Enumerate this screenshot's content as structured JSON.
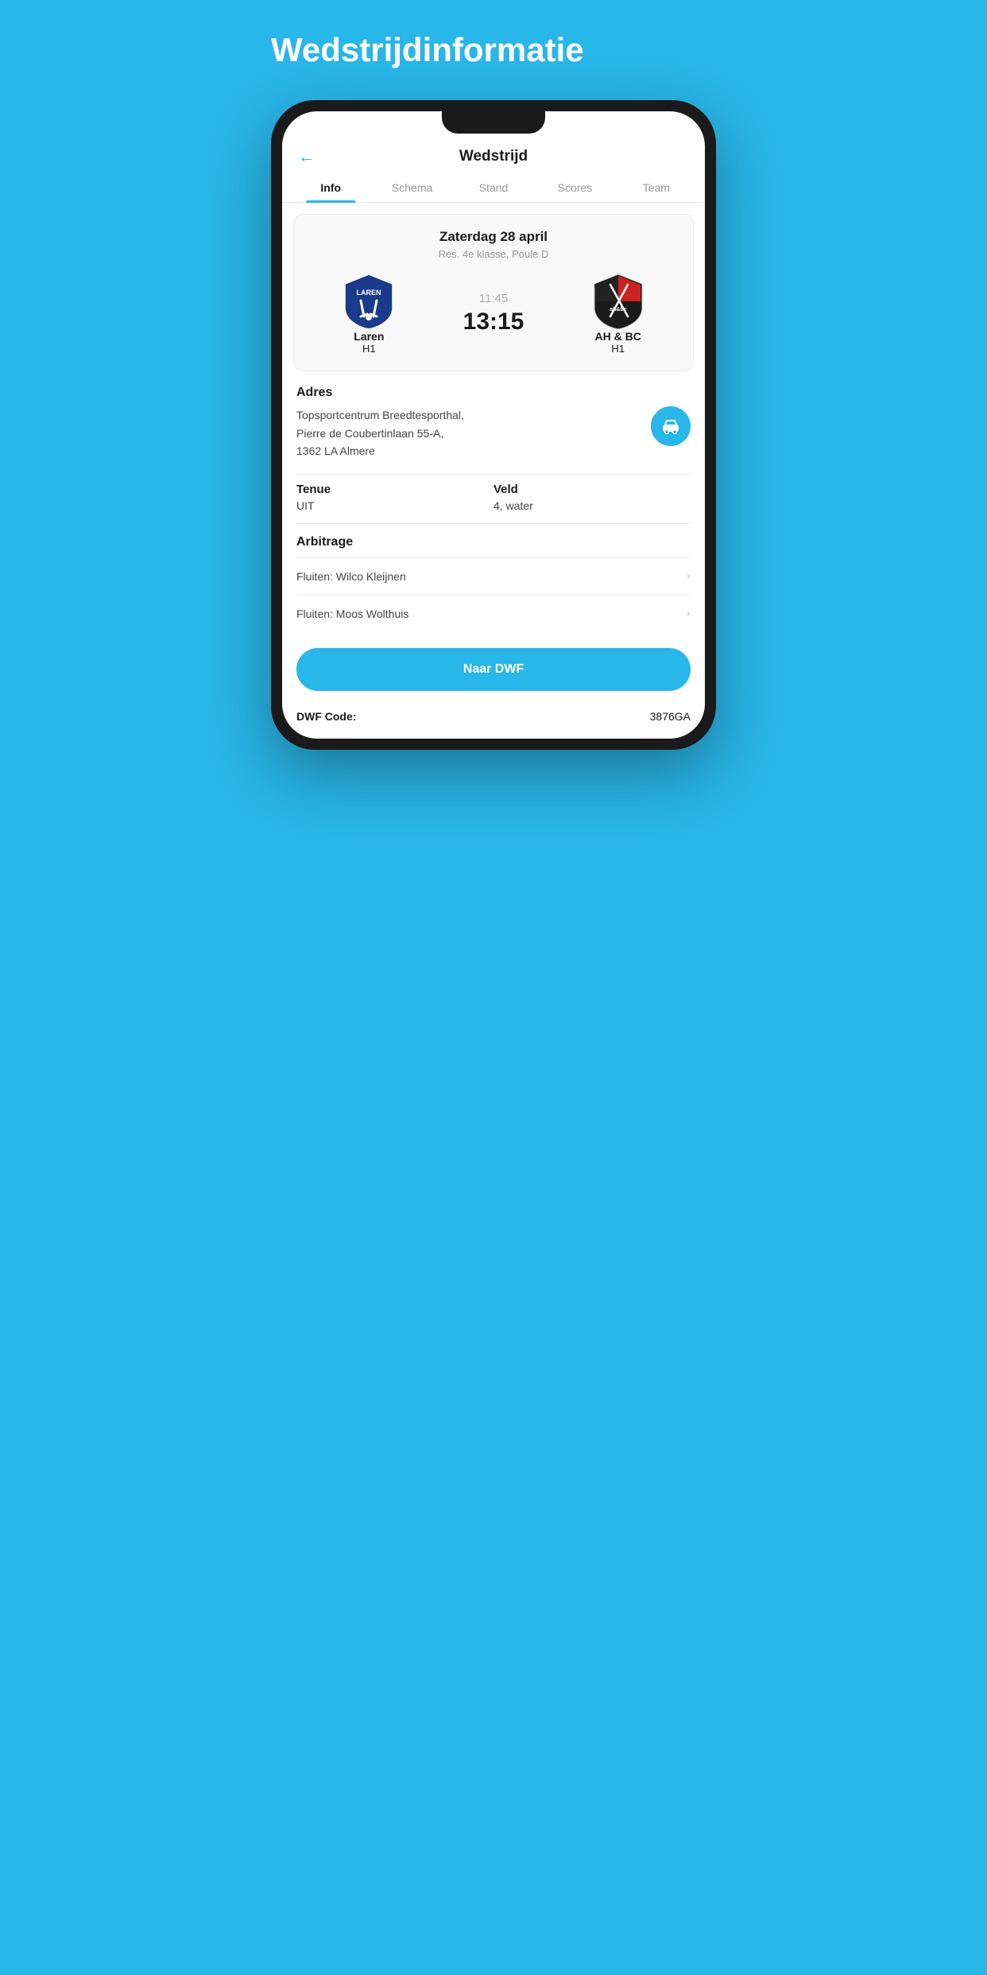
{
  "page": {
    "bg_title": "Wedstrijdinformatie"
  },
  "header": {
    "title": "Wedstrijd",
    "back_icon": "←"
  },
  "tabs": [
    {
      "label": "Info",
      "active": true
    },
    {
      "label": "Schema",
      "active": false
    },
    {
      "label": "Stand",
      "active": false
    },
    {
      "label": "Scores",
      "active": false
    },
    {
      "label": "Team",
      "active": false
    }
  ],
  "match": {
    "date": "Zaterdag 28 april",
    "league": "Res. 4e klasse, Poule D",
    "home_team": "Laren",
    "home_sub": "H1",
    "away_team": "AH & BC",
    "away_sub": "H1",
    "time": "11:45",
    "score": "13:15"
  },
  "address": {
    "label": "Adres",
    "text_line1": "Topsportcentrum Breedtesporthal,",
    "text_line2": "Pierre de Coubertinlaan 55-A,",
    "text_line3": "1362 LA Almere"
  },
  "tenue": {
    "label": "Tenue",
    "value": "UIT"
  },
  "veld": {
    "label": "Veld",
    "value": "4, water"
  },
  "arbitrage": {
    "label": "Arbitrage",
    "referees": [
      {
        "text": "Fluiten: Wilco Kleijnen"
      },
      {
        "text": "Fluiten: Moos Wolthuis"
      }
    ]
  },
  "dwf": {
    "button_label": "Naar DWF",
    "code_label": "DWF Code:",
    "code_value": "3876GA"
  },
  "colors": {
    "primary": "#29b6e8",
    "text_dark": "#1a1a1a",
    "text_gray": "#999999"
  }
}
